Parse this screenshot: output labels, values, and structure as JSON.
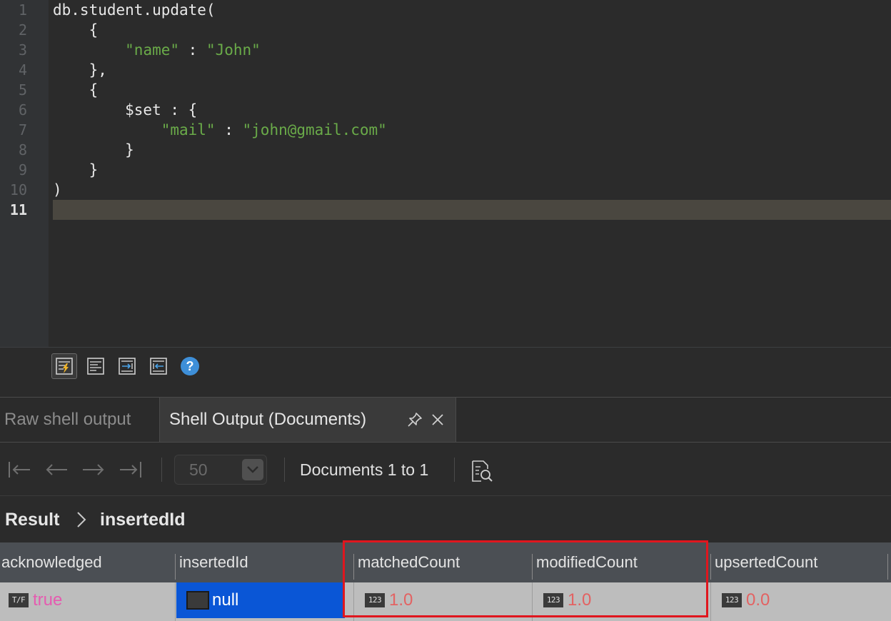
{
  "editor": {
    "line_numbers": [
      "1",
      "2",
      "3",
      "4",
      "5",
      "6",
      "7",
      "8",
      "9",
      "10",
      "11"
    ],
    "active_line": "11",
    "lines": [
      {
        "text": "db.student.update(",
        "str": "",
        "rest": ""
      },
      {
        "text": "    {",
        "str": "",
        "rest": ""
      },
      {
        "text": "        ",
        "str": "\"name\"",
        "rest": " : ",
        "str2": "\"John\""
      },
      {
        "text": "    },",
        "str": "",
        "rest": ""
      },
      {
        "text": "    {",
        "str": "",
        "rest": ""
      },
      {
        "text": "        $set : {",
        "str": "",
        "rest": ""
      },
      {
        "text": "            ",
        "str": "\"mail\"",
        "rest": " : ",
        "str2": "\"john@gmail.com\""
      },
      {
        "text": "        }",
        "str": "",
        "rest": ""
      },
      {
        "text": "    }",
        "str": "",
        "rest": ""
      },
      {
        "text": ")",
        "str": "",
        "rest": ""
      }
    ]
  },
  "editor_toolbar": {
    "icons": [
      "execute-icon",
      "format-icon",
      "indent-icon",
      "outdent-icon",
      "help-icon"
    ],
    "help_glyph": "?"
  },
  "tabs": {
    "raw": "Raw shell output",
    "documents": "Shell Output (Documents)"
  },
  "nav": {
    "page_size": "50",
    "range": "Documents 1 to 1"
  },
  "breadcrumb": {
    "root": "Result",
    "current": "insertedId"
  },
  "grid": {
    "columns": [
      "acknowledged",
      "insertedId",
      "matchedCount",
      "modifiedCount",
      "upsertedCount"
    ],
    "row": {
      "acknowledged": {
        "type": "T/F",
        "value": "true"
      },
      "insertedId": {
        "value": "null"
      },
      "matchedCount": {
        "type": "123",
        "value": "1.0"
      },
      "modifiedCount": {
        "type": "123",
        "value": "1.0"
      },
      "upsertedCount": {
        "type": "123",
        "value": "0.0"
      }
    }
  },
  "colors": {
    "string": "#6aab49",
    "boolean": "#e55bb0",
    "number": "#e36262",
    "selection": "#0a56d6",
    "highlight": "#e0161e"
  }
}
